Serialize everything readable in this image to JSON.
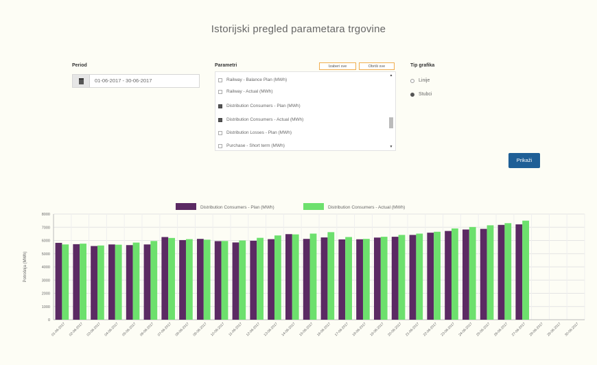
{
  "page": {
    "title": "Istorijski pregled parametara trgovine"
  },
  "period": {
    "label": "Period",
    "value": "01-06-2017 - 30-06-2017"
  },
  "parameters": {
    "label": "Parametri",
    "select_all": "Izaberi sve",
    "deselect_all": "Obriši sve",
    "items": [
      {
        "label": "Railway - Balance Plan (MWh)",
        "checked": false
      },
      {
        "label": "Railway - Actual (MWh)",
        "checked": false
      },
      {
        "label": "Distribution Consumers - Plan (MWh)",
        "checked": true
      },
      {
        "label": "Distribution Consumers - Actual (MWh)",
        "checked": true
      },
      {
        "label": "Distribution Losses - Plan (MWh)",
        "checked": false
      },
      {
        "label": "Purchase - Short term (MWh)",
        "checked": false
      }
    ]
  },
  "chart_type": {
    "label": "Tip grafika",
    "options": [
      {
        "label": "Linije",
        "selected": false
      },
      {
        "label": "Stubci",
        "selected": true
      }
    ]
  },
  "buttons": {
    "show": "Prikaži"
  },
  "colors": {
    "plan": "#5b2a63",
    "actual": "#6de06d",
    "button": "#1f5f96"
  },
  "chart_data": {
    "type": "bar",
    "ylabel": "Potrošnja (MWh)",
    "ylim": [
      0,
      8000
    ],
    "yticks": [
      0,
      1000,
      2000,
      3000,
      4000,
      5000,
      6000,
      7000,
      8000
    ],
    "categories": [
      "01-06-2017",
      "02-06-2017",
      "03-06-2017",
      "04-06-2017",
      "05-06-2017",
      "06-06-2017",
      "07-06-2017",
      "08-06-2017",
      "09-06-2017",
      "10-06-2017",
      "11-06-2017",
      "12-06-2017",
      "13-06-2017",
      "14-06-2017",
      "15-06-2017",
      "16-06-2017",
      "17-06-2017",
      "18-06-2017",
      "19-06-2017",
      "20-06-2017",
      "21-06-2017",
      "22-06-2017",
      "23-06-2017",
      "24-06-2017",
      "25-06-2017",
      "26-06-2017",
      "27-06-2017",
      "28-06-2017",
      "29-06-2017",
      "30-06-2017"
    ],
    "series": [
      {
        "name": "Distribution Consumers - Plan (MWh)",
        "values": [
          5820,
          5720,
          5580,
          5700,
          5650,
          5700,
          6260,
          6030,
          6120,
          5950,
          5850,
          5980,
          6100,
          6480,
          6120,
          6230,
          6080,
          6090,
          6220,
          6280,
          6420,
          6590,
          6720,
          6830,
          6880,
          7180,
          7220,
          null,
          null,
          null
        ]
      },
      {
        "name": "Distribution Consumers - Actual (MWh)",
        "values": [
          5700,
          5760,
          5620,
          5680,
          5840,
          5960,
          6190,
          6100,
          6060,
          5960,
          6000,
          6200,
          6380,
          6460,
          6520,
          6630,
          6260,
          6120,
          6280,
          6420,
          6520,
          6660,
          6910,
          7020,
          7150,
          7310,
          7500,
          null,
          null,
          null
        ]
      }
    ]
  }
}
